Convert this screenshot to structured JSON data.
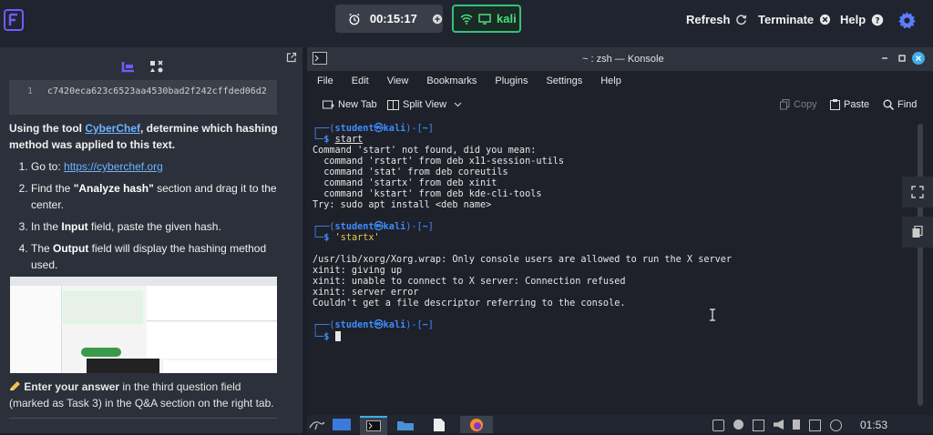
{
  "topbar": {
    "timer": "00:15:17",
    "vm_name": "kali",
    "refresh_label": "Refresh",
    "terminate_label": "Terminate",
    "help_label": "Help"
  },
  "left_panel": {
    "hash_line_number": "1",
    "hash": "c7420eca623c6523aa4530bad2f242cffded06d2",
    "intro_prefix": "Using the tool ",
    "intro_link": "CyberChef",
    "intro_suffix": ", determine which hashing method was applied to this text.",
    "steps": [
      {
        "prefix": "Go to: ",
        "link": "https://cyberchef.org",
        "bold": "",
        "suffix": ""
      },
      {
        "prefix": "Find the ",
        "link": "",
        "bold": "\"Analyze hash\"",
        "suffix": " section and drag it to the center."
      },
      {
        "prefix": "In the ",
        "link": "",
        "bold": "Input",
        "suffix": " field, paste the given hash."
      },
      {
        "prefix": "The ",
        "link": "",
        "bold": "Output",
        "suffix": " field will display the hashing method used."
      }
    ],
    "answer_bold": "Enter your answer",
    "answer_rest": " in the third question field (marked as Task 3) in the Q&A section on the right tab."
  },
  "konsole": {
    "title": "~ : zsh — Konsole",
    "menu": [
      "File",
      "Edit",
      "View",
      "Bookmarks",
      "Plugins",
      "Settings",
      "Help"
    ],
    "toolbar": {
      "new_tab": "New Tab",
      "split_view": "Split View",
      "copy": "Copy",
      "paste": "Paste",
      "find": "Find"
    },
    "prompt_user": "student",
    "prompt_host": "kali",
    "prompt_dir": "~",
    "cmd1": "start",
    "output1": [
      "Command 'start' not found, did you mean:",
      "  command 'rstart' from deb x11-session-utils",
      "  command 'stat' from deb coreutils",
      "  command 'startx' from deb xinit",
      "  command 'kstart' from deb kde-cli-tools",
      "Try: sudo apt install <deb name>"
    ],
    "cmd2": "'startx'",
    "output2": [
      "/usr/lib/xorg/Xorg.wrap: Only console users are allowed to run the X server",
      "xinit: giving up",
      "xinit: unable to connect to X server: Connection refused",
      "xinit: server error",
      "Couldn't get a file descriptor referring to the console."
    ]
  },
  "taskbar": {
    "clock": "01:53"
  },
  "colors": {
    "accent_green": "#35c27a",
    "prompt_blue": "#3f8cff",
    "link_blue": "#6fb4ff",
    "gear_blue": "#5b7cff"
  }
}
